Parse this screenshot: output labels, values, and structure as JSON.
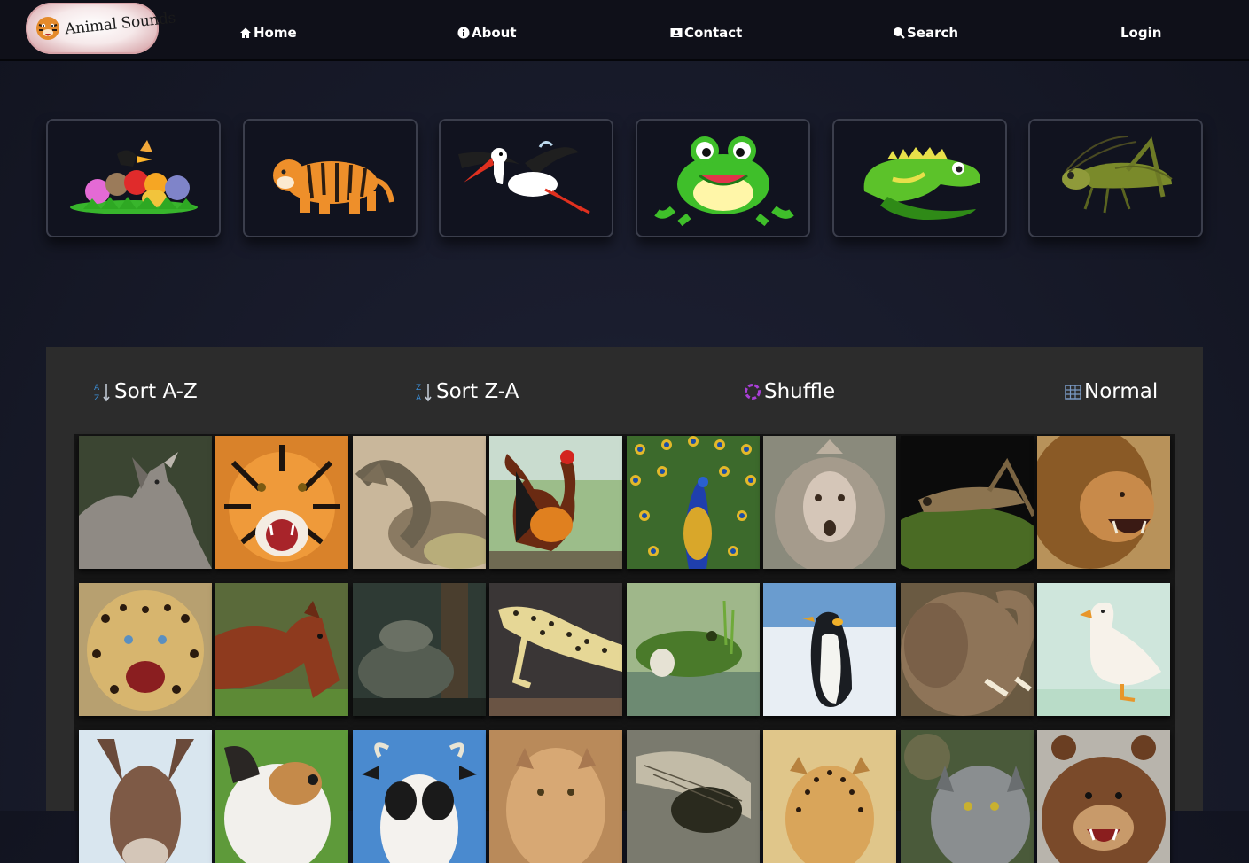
{
  "nav": {
    "logo_text": "Animal Sounds",
    "items": [
      {
        "label": "Home",
        "icon": "home-icon"
      },
      {
        "label": "About",
        "icon": "info-icon"
      },
      {
        "label": "Contact",
        "icon": "contact-card-icon"
      },
      {
        "label": "Search",
        "icon": "search-icon"
      },
      {
        "label": "Login",
        "icon": ""
      }
    ]
  },
  "categories": [
    {
      "name": "all-animals",
      "icon": "animal-group-icon"
    },
    {
      "name": "mammals",
      "icon": "tiger-icon"
    },
    {
      "name": "birds",
      "icon": "stork-icon"
    },
    {
      "name": "amphibians",
      "icon": "frog-icon"
    },
    {
      "name": "reptiles",
      "icon": "iguana-icon"
    },
    {
      "name": "insects",
      "icon": "grasshopper-icon"
    }
  ],
  "sort": {
    "az": "Sort A-Z",
    "za": "Sort Z-A",
    "shuffle": "Shuffle",
    "normal": "Normal"
  },
  "colors": {
    "shuffle_accent": "#a93fd6",
    "sort_accent": "#3b8fd9",
    "nav_bg": "#0f1019",
    "panel_bg": "#2c2c2c"
  },
  "animals": [
    "wolf",
    "tiger",
    "rattlesnake",
    "rooster",
    "peacock",
    "macaque",
    "grasshopper",
    "lion",
    "leopard",
    "horse",
    "turtle",
    "gecko",
    "frog",
    "penguin",
    "elephant",
    "duck",
    "donkey",
    "dog",
    "cow",
    "cougar",
    "cicada",
    "cheetah",
    "cat",
    "bear"
  ]
}
